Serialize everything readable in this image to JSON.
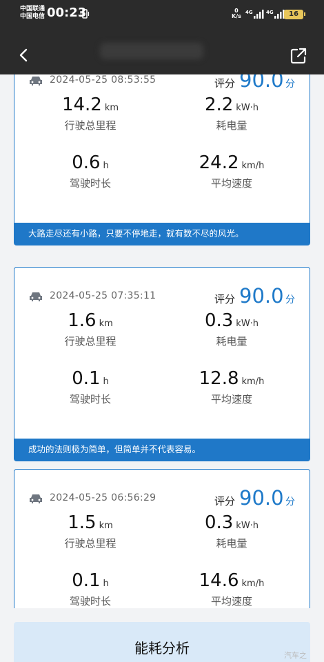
{
  "status_bar": {
    "carrier1": "中国联通",
    "carrier2": "中国电信",
    "time": "00:23",
    "net_speed_value": "0",
    "net_speed_unit": "K/s",
    "net_type1": "4G",
    "net_type2": "4G",
    "battery": "16"
  },
  "header": {
    "title": "",
    "back_icon": "chevron-left-icon",
    "share_icon": "share-icon"
  },
  "trips": [
    {
      "datetime": "2024-05-25 08:53:55",
      "score_label": "评分",
      "score": "90.0",
      "score_unit": "分",
      "distance": "14.2",
      "distance_unit": "km",
      "distance_label": "行驶总里程",
      "energy": "2.2",
      "energy_unit": "kW·h",
      "energy_label": "耗电量",
      "duration": "0.6",
      "duration_unit": "h",
      "duration_label": "驾驶时长",
      "speed": "24.2",
      "speed_unit": "km/h",
      "speed_label": "平均速度",
      "quote": "大路走尽还有小路，只要不停地走，就有数不尽的风光。"
    },
    {
      "datetime": "2024-05-25 07:35:11",
      "score_label": "评分",
      "score": "90.0",
      "score_unit": "分",
      "distance": "1.6",
      "distance_unit": "km",
      "distance_label": "行驶总里程",
      "energy": "0.3",
      "energy_unit": "kW·h",
      "energy_label": "耗电量",
      "duration": "0.1",
      "duration_unit": "h",
      "duration_label": "驾驶时长",
      "speed": "12.8",
      "speed_unit": "km/h",
      "speed_label": "平均速度",
      "quote": "成功的法则极为简单，但简单并不代表容易。"
    },
    {
      "datetime": "2024-05-25 06:56:29",
      "score_label": "评分",
      "score": "90.0",
      "score_unit": "分",
      "distance": "1.5",
      "distance_unit": "km",
      "distance_label": "行驶总里程",
      "energy": "0.3",
      "energy_unit": "kW·h",
      "energy_label": "耗电量",
      "duration": "0.1",
      "duration_unit": "h",
      "duration_label": "驾驶时长",
      "speed": "14.6",
      "speed_unit": "km/h",
      "speed_label": "平均速度",
      "quote": ""
    }
  ],
  "bottom_button": "能耗分析",
  "watermark": "汽车之"
}
